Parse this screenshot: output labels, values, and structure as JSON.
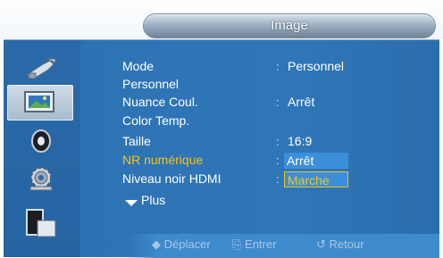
{
  "header": {
    "title": "Image"
  },
  "sidebar": {
    "items": [
      {
        "icon": "input-plug-icon"
      },
      {
        "icon": "picture-icon",
        "active": true
      },
      {
        "icon": "sound-icon"
      },
      {
        "icon": "setup-gear-icon"
      },
      {
        "icon": "multi-window-icon"
      }
    ]
  },
  "menu": {
    "rows": [
      {
        "label": "Mode",
        "value": "Personnel"
      },
      {
        "label": "Personnel"
      },
      {
        "label": "Nuance Coul.",
        "value": "Arrêt"
      },
      {
        "label": "Color Temp."
      },
      {
        "label": "Taille",
        "value": "16:9"
      },
      {
        "label": "NR numérique",
        "highlighted": true
      },
      {
        "label": "Niveau noir HDMI"
      }
    ],
    "plus_label": "Plus",
    "separator": ":"
  },
  "dropdown": {
    "options": [
      "Arrêt",
      "Marche"
    ],
    "selected": "Arrêt",
    "focused": "Marche"
  },
  "footer": {
    "move_label": "Déplacer",
    "enter_label": "Entrer",
    "return_label": "Retour"
  }
}
